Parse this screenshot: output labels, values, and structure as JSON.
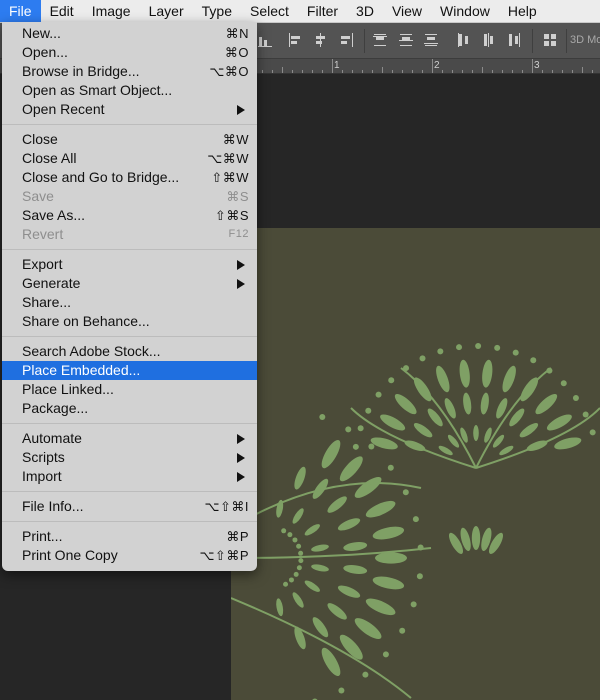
{
  "menubar": {
    "items": [
      "File",
      "Edit",
      "Image",
      "Layer",
      "Type",
      "Select",
      "Filter",
      "3D",
      "View",
      "Window",
      "Help"
    ],
    "active": "File"
  },
  "options_bar": {
    "icons": [
      "align-bottom-edges-icon",
      "align-left-edges-icon",
      "align-horizontal-centers-icon",
      "align-right-edges-icon",
      "distribute-top-edges-icon",
      "distribute-vertical-centers-icon",
      "distribute-bottom-edges-icon",
      "distribute-left-edges-icon",
      "distribute-horizontal-centers-icon",
      "distribute-right-edges-icon",
      "auto-align-layers-icon"
    ],
    "mode_label": "3D Mo"
  },
  "ruler": {
    "labels": [
      "1",
      "2",
      "3"
    ]
  },
  "file_menu": {
    "groups": [
      [
        {
          "label": "New...",
          "shortcut": "⌘N"
        },
        {
          "label": "Open...",
          "shortcut": "⌘O"
        },
        {
          "label": "Browse in Bridge...",
          "shortcut": "⌥⌘O"
        },
        {
          "label": "Open as Smart Object...",
          "shortcut": ""
        },
        {
          "label": "Open Recent",
          "submenu": true
        }
      ],
      [
        {
          "label": "Close",
          "shortcut": "⌘W"
        },
        {
          "label": "Close All",
          "shortcut": "⌥⌘W"
        },
        {
          "label": "Close and Go to Bridge...",
          "shortcut": "⇧⌘W"
        },
        {
          "label": "Save",
          "shortcut": "⌘S",
          "disabled": true
        },
        {
          "label": "Save As...",
          "shortcut": "⇧⌘S"
        },
        {
          "label": "Revert",
          "shortcut": "F12",
          "disabled": true
        }
      ],
      [
        {
          "label": "Export",
          "submenu": true
        },
        {
          "label": "Generate",
          "submenu": true
        },
        {
          "label": "Share...",
          "shortcut": ""
        },
        {
          "label": "Share on Behance...",
          "shortcut": ""
        }
      ],
      [
        {
          "label": "Search Adobe Stock...",
          "shortcut": ""
        },
        {
          "label": "Place Embedded...",
          "shortcut": "",
          "highlighted": true
        },
        {
          "label": "Place Linked...",
          "shortcut": ""
        },
        {
          "label": "Package...",
          "shortcut": ""
        }
      ],
      [
        {
          "label": "Automate",
          "submenu": true
        },
        {
          "label": "Scripts",
          "submenu": true
        },
        {
          "label": "Import",
          "submenu": true
        }
      ],
      [
        {
          "label": "File Info...",
          "shortcut": "⌥⇧⌘I"
        }
      ],
      [
        {
          "label": "Print...",
          "shortcut": "⌘P"
        },
        {
          "label": "Print One Copy",
          "shortcut": "⌥⇧⌘P"
        }
      ]
    ]
  },
  "document": {
    "background_color": "#4b4b38",
    "pattern_color": "#7fa065",
    "description": "botanical leaf pattern"
  },
  "colors": {
    "menu_highlight": "#1f6fe0",
    "menubar_active": "#2d7cf0"
  }
}
